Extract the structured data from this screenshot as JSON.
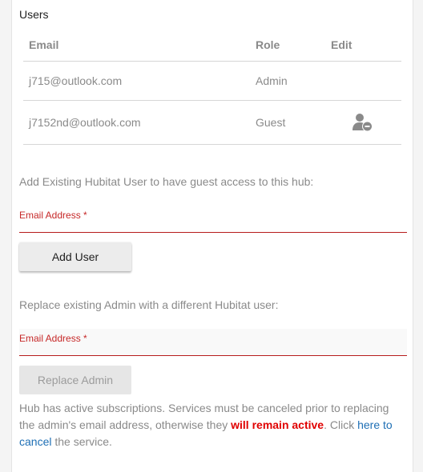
{
  "users_section": {
    "title": "Users",
    "table": {
      "headers": {
        "email": "Email",
        "role": "Role",
        "edit": "Edit"
      },
      "rows": [
        {
          "email": "j715@outlook.com",
          "role": "Admin",
          "edit_action": null
        },
        {
          "email": "j7152nd@outlook.com",
          "role": "Guest",
          "edit_action": "remove-user-icon"
        }
      ]
    }
  },
  "add_user": {
    "prompt": "Add Existing Hubitat User to have guest access to this hub:",
    "email_label": "Email Address *",
    "email_value": "",
    "button_label": "Add User"
  },
  "replace_admin": {
    "prompt": "Replace existing Admin with a different Hubitat user:",
    "email_label": "Email Address *",
    "email_value": "",
    "button_label": "Replace Admin",
    "button_disabled": true
  },
  "subscription_notice": {
    "text_before": "Hub has active subscriptions. Services must be canceled prior to replacing the admin's email address, otherwise they ",
    "warning": "will remain active",
    "text_middle": ". Click ",
    "link": "here to cancel",
    "text_after": " the service."
  },
  "colors": {
    "accent_red": "#c62828",
    "warning_red": "#e00000",
    "link_blue": "#1e6fb5",
    "muted_text": "#8a8a8a"
  }
}
